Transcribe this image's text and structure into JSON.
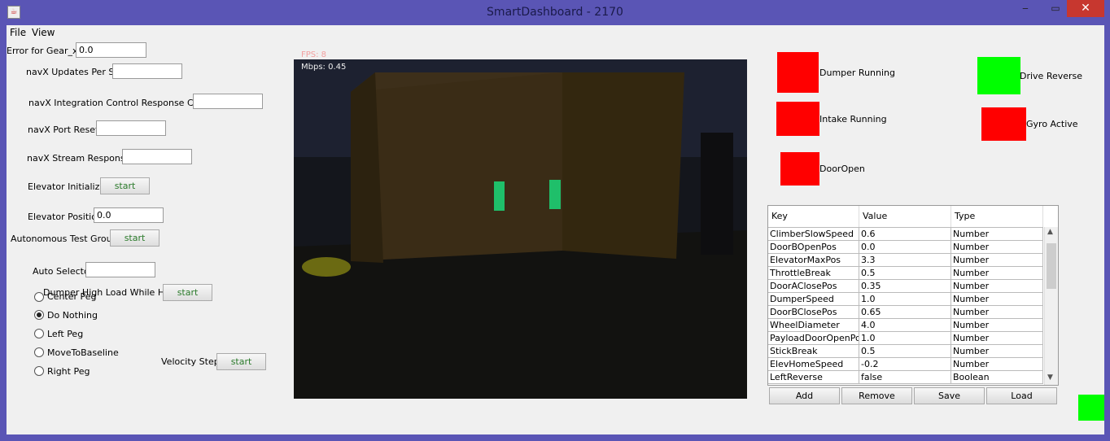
{
  "window": {
    "title": "SmartDashboard - 2170",
    "minimize": "‒",
    "maximize": "▭",
    "close": "✕"
  },
  "menu": [
    "File",
    "View"
  ],
  "left": {
    "error_gear_label": "Error for Gear_x:",
    "error_gear_value": "0.0",
    "navx_updates_label": "navX Updates Per Sec",
    "navx_updates_value": "",
    "navx_integration_label": "navX Integration Control Response Count",
    "navx_integration_value": "",
    "navx_port_resets_label": "navX Port Resets",
    "navx_port_resets_value": "",
    "navx_stream_label": "navX Stream Responses",
    "navx_stream_value": "",
    "elevator_init_label": "Elevator Initialize",
    "elevator_init_button": "start",
    "elevator_pos_label": "Elevator Position",
    "elevator_pos_value": "0.0",
    "auto_test_label": "Autonomous Test Group",
    "auto_test_button": "start",
    "auto_selector_label": "Auto Selector",
    "auto_selector_value": "",
    "dumper_high_label": "Dumper High Load While Held",
    "dumper_high_button": "start",
    "velocity_step_label": "Velocity Step",
    "velocity_step_button": "start",
    "auto_options": [
      {
        "label": "Center Peg",
        "selected": false
      },
      {
        "label": "Do Nothing",
        "selected": true
      },
      {
        "label": "Left Peg",
        "selected": false
      },
      {
        "label": "MoveToBaseline",
        "selected": false
      },
      {
        "label": "Right Peg",
        "selected": false
      }
    ]
  },
  "camera": {
    "fps": "FPS: 8",
    "mbps": "Mbps: 0.45"
  },
  "indicators": [
    {
      "label": "Dumper Running",
      "color": "#ff0000"
    },
    {
      "label": "Intake Running",
      "color": "#ff0000"
    },
    {
      "label": "DoorOpen",
      "color": "#ff0000"
    },
    {
      "label": "Drive Reverse",
      "color": "#00ff00"
    },
    {
      "label": "Gyro Active",
      "color": "#ff0000"
    }
  ],
  "corner_indicator_color": "#00ff00",
  "table": {
    "headers": [
      "Key",
      "Value",
      "Type"
    ],
    "rows": [
      [
        "ClimberSlowSpeed",
        "0.6",
        "Number"
      ],
      [
        "DoorBOpenPos",
        "0.0",
        "Number"
      ],
      [
        "ElevatorMaxPos",
        "3.3",
        "Number"
      ],
      [
        "ThrottleBreak",
        "0.5",
        "Number"
      ],
      [
        "DoorAClosePos",
        "0.35",
        "Number"
      ],
      [
        "DumperSpeed",
        "1.0",
        "Number"
      ],
      [
        "DoorBClosePos",
        "0.65",
        "Number"
      ],
      [
        "WheelDiameter",
        "4.0",
        "Number"
      ],
      [
        "PayloadDoorOpenPos",
        "1.0",
        "Number"
      ],
      [
        "StickBreak",
        "0.5",
        "Number"
      ],
      [
        "ElevHomeSpeed",
        "-0.2",
        "Number"
      ],
      [
        "LeftReverse",
        "false",
        "Boolean"
      ]
    ],
    "buttons": [
      "Add",
      "Remove",
      "Save",
      "Load"
    ]
  }
}
